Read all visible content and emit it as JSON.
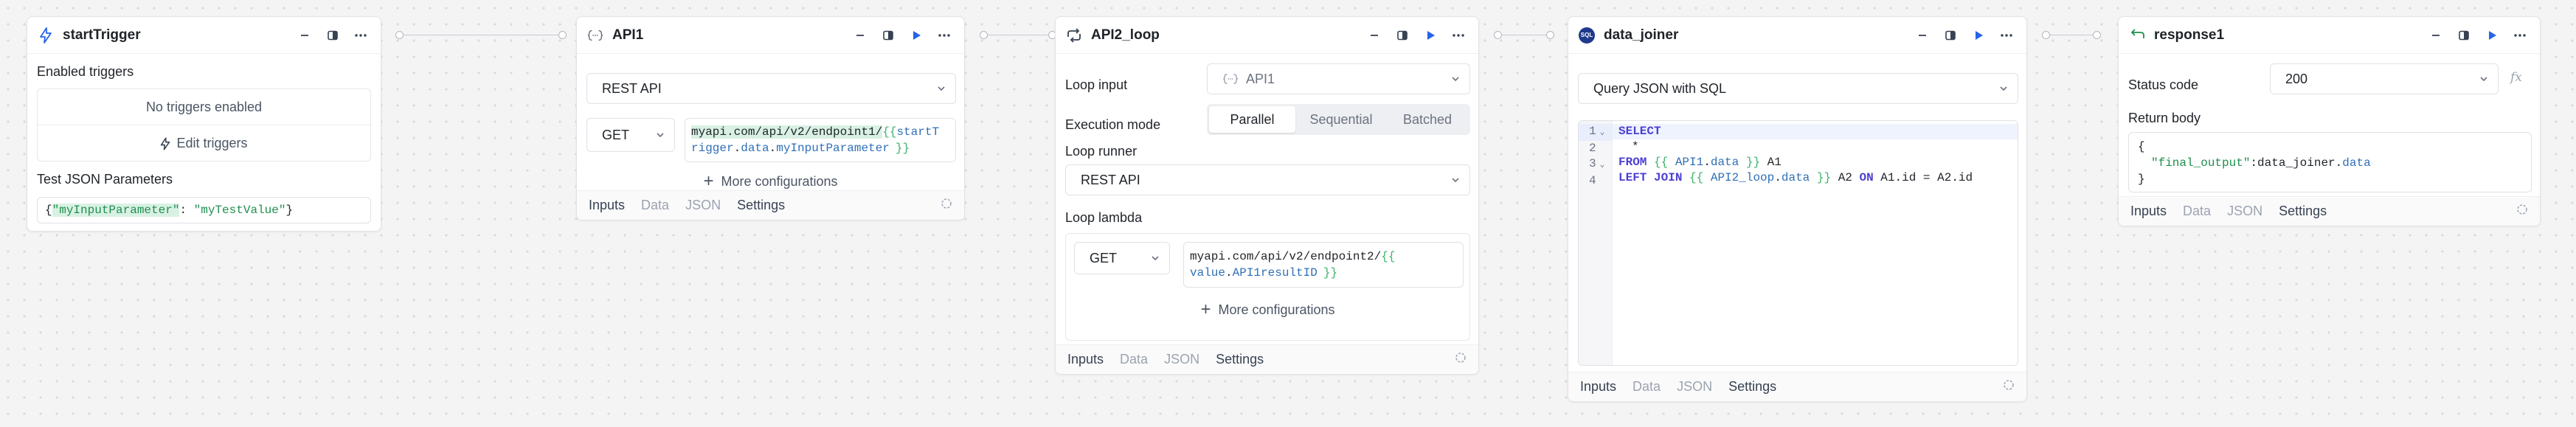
{
  "colors": {
    "accent": "#2563eb",
    "template_brace": "#3bb36b",
    "template_var": "#2f6fb5",
    "sql_keyword": "#4c3fd1",
    "string": "#1f8f4e"
  },
  "footer_tabs": [
    "Inputs",
    "Data",
    "JSON",
    "Settings"
  ],
  "start_trigger": {
    "title": "startTrigger",
    "enabled_label": "Enabled triggers",
    "no_triggers": "No triggers enabled",
    "edit_triggers": "Edit triggers",
    "test_params_label": "Test JSON Parameters",
    "json_open": "{",
    "json_key": "\"myInputParameter\"",
    "json_sep": ": ",
    "json_value": "\"myTestValue\"",
    "json_close": "}"
  },
  "api1": {
    "title": "API1",
    "type": "REST API",
    "method": "GET",
    "url_static": "myapi.com/api/v2/endpoint1/",
    "url_open": "{{",
    "url_var1": "startT",
    "url_var2": "rigger",
    "url_dot1": ".",
    "url_var3": "data",
    "url_dot2": ".",
    "url_var4": "myInputParameter",
    "url_close": "}}",
    "more": "More configurations"
  },
  "api2_loop": {
    "title": "API2_loop",
    "loop_input_label": "Loop input",
    "loop_input_value": "API1",
    "execution_mode_label": "Execution mode",
    "modes": [
      "Parallel",
      "Sequential",
      "Batched"
    ],
    "loop_runner_label": "Loop runner",
    "loop_runner_value": "REST API",
    "loop_lambda_label": "Loop lambda",
    "method": "GET",
    "url_static": "myapi.com/api/v2/endpoint2/",
    "url_open": "{{",
    "url_var1": "value",
    "url_dot": ".",
    "url_var2": "API1resultID",
    "url_close": "}}",
    "more": "More configurations"
  },
  "data_joiner": {
    "title": "data_joiner",
    "badge": "SQL",
    "type": "Query JSON with SQL",
    "lines": [
      "1",
      "2",
      "3",
      "4"
    ],
    "l1_kw": "SELECT",
    "l2": "*",
    "l3_kw": "FROM",
    "l3_open": "{{",
    "l3_var1": "API1",
    "l3_dot": ".",
    "l3_var2": "data",
    "l3_close": "}}",
    "l3_alias": " A1",
    "l4_kw1": "LEFT JOIN",
    "l4_open": "{{",
    "l4_var1": "API2_loop",
    "l4_dot": ".",
    "l4_var2": "data",
    "l4_close": "}}",
    "l4_alias": " A2 ",
    "l4_kw2": "ON",
    "l4_cond": " A1.id = A2.id"
  },
  "response1": {
    "title": "response1",
    "status_label": "Status code",
    "status_value": "200",
    "fx": "fx",
    "return_label": "Return body",
    "body_open": "{",
    "body_key": "\"final_output\"",
    "body_sep": ":",
    "body_var1": "data_joiner",
    "body_dot": ".",
    "body_var2": "data",
    "body_close": "}"
  }
}
